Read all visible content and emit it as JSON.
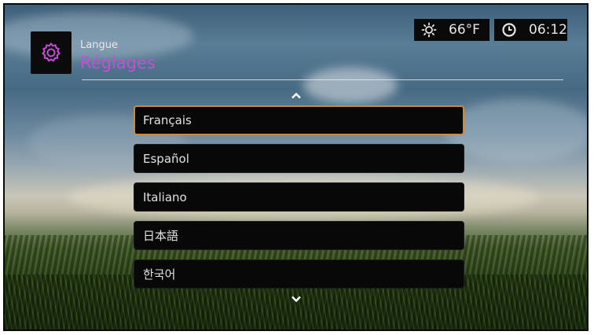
{
  "header": {
    "breadcrumb": "Langue",
    "title": "Réglages",
    "app_icon": "gear-icon"
  },
  "status_bar": {
    "weather_icon": "sun-icon",
    "temperature": "66°F",
    "clock_icon": "clock-icon",
    "time": "06:12"
  },
  "languages": {
    "items": [
      {
        "label": "Français",
        "selected": true
      },
      {
        "label": "Español",
        "selected": false
      },
      {
        "label": "Italiano",
        "selected": false
      },
      {
        "label": "日本語",
        "selected": false
      },
      {
        "label": "한국어",
        "selected": false
      }
    ],
    "scroll_up_icon": "chevron-up-icon",
    "scroll_down_icon": "chevron-down-icon"
  },
  "colors": {
    "accent": "#c34fd6",
    "selection_border": "#c98a3d",
    "item_background": "#080808"
  }
}
